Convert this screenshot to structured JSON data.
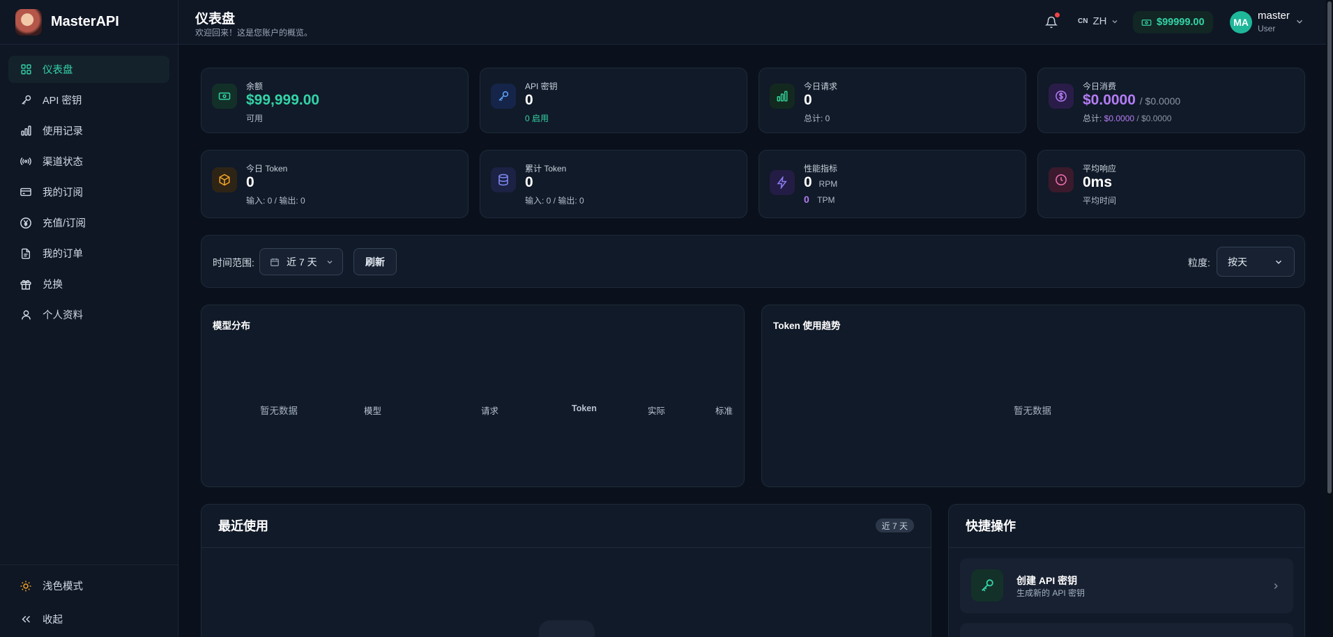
{
  "brand": {
    "name": "MasterAPI"
  },
  "sidebar": {
    "items": [
      {
        "label": "仪表盘",
        "icon": "dashboard-icon",
        "active": true
      },
      {
        "label": "API 密钥",
        "icon": "key-icon"
      },
      {
        "label": "使用记录",
        "icon": "bar-chart-icon"
      },
      {
        "label": "渠道状态",
        "icon": "signal-icon"
      },
      {
        "label": "我的订阅",
        "icon": "card-icon"
      },
      {
        "label": "充值/订阅",
        "icon": "yen-icon"
      },
      {
        "label": "我的订单",
        "icon": "document-icon"
      },
      {
        "label": "兑换",
        "icon": "gift-icon"
      },
      {
        "label": "个人资料",
        "icon": "user-icon"
      }
    ],
    "theme_label": "浅色模式",
    "collapse_label": "收起"
  },
  "header": {
    "title": "仪表盘",
    "subtitle": "欢迎回来！这是您账户的概览。",
    "lang_flag": "CN",
    "lang": "ZH",
    "balance": "$99999.00",
    "avatar_initials": "MA",
    "user_name": "master",
    "user_role": "User"
  },
  "stats": {
    "balance": {
      "label": "余额",
      "value": "$99,999.00",
      "sub": "可用"
    },
    "api_keys": {
      "label": "API 密钥",
      "value": "0",
      "sub": "0 启用"
    },
    "today_requests": {
      "label": "今日请求",
      "value": "0",
      "sub": "总计: 0"
    },
    "today_cost": {
      "label": "今日消费",
      "value": "$0.0000",
      "value_suffix": "/ $0.0000",
      "sub_prefix": "总计: ",
      "sub_value": "$0.0000",
      "sub_suffix": " / $0.0000"
    },
    "today_token": {
      "label": "今日 Token",
      "value": "0",
      "sub": "输入: 0 / 输出: 0"
    },
    "total_token": {
      "label": "累计 Token",
      "value": "0",
      "sub": "输入: 0 / 输出: 0"
    },
    "performance": {
      "label": "性能指标",
      "rpm": "0",
      "rpm_unit": "RPM",
      "tpm": "0",
      "tpm_unit": "TPM"
    },
    "avg_response": {
      "label": "平均响应",
      "value": "0ms",
      "sub": "平均时间"
    }
  },
  "filters": {
    "range_label": "时间范围:",
    "range_value": "近 7 天",
    "refresh_label": "刷新",
    "granularity_label": "粒度:",
    "granularity_value": "按天"
  },
  "model_dist": {
    "title": "模型分布",
    "empty": "暂无数据",
    "columns": [
      "模型",
      "请求",
      "Token",
      "实际",
      "标准"
    ]
  },
  "token_trend": {
    "title": "Token 使用趋势",
    "empty": "暂无数据"
  },
  "recent": {
    "title": "最近使用",
    "badge": "近 7 天"
  },
  "quick": {
    "title": "快捷操作",
    "items": [
      {
        "title": "创建 API 密钥",
        "desc": "生成新的 API 密钥"
      }
    ]
  },
  "colors": {
    "accent": "#34d3a7",
    "purple": "#b47cf5",
    "background": "#0a111c"
  }
}
